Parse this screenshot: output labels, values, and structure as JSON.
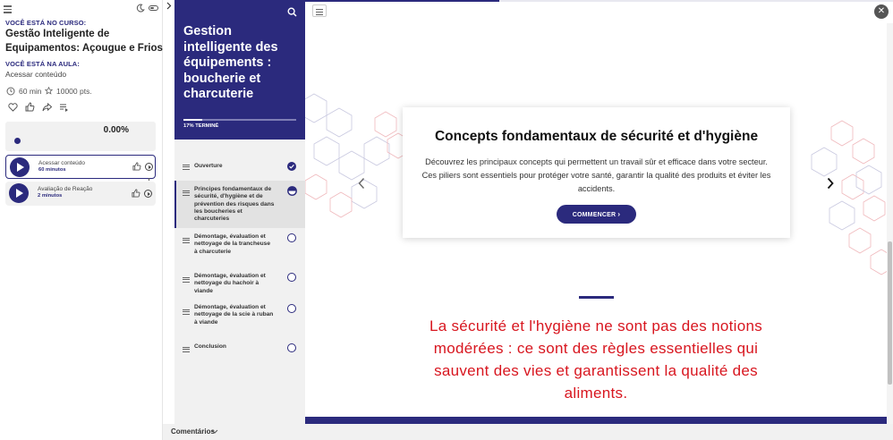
{
  "left": {
    "course_label": "VOCÊ ESTÁ NO CURSO:",
    "course_title": "Gestão Inteligente de Equipamentos: Açougue e Frios",
    "lesson_label": "VOCÊ ESTÁ NA AULA:",
    "lesson_name": "Acessar conteúdo",
    "duration": "60 min",
    "points": "10000 pts.",
    "progress_text": "0.00%",
    "progress": 0.0,
    "lessons": [
      {
        "title": "Acessar conteúdo",
        "subtitle": "60 minutos"
      },
      {
        "title": "Avaliação de Reação",
        "subtitle": "2 minutos"
      }
    ]
  },
  "module": {
    "title": "Gestion intelligente des équipements : boucherie et charcuterie",
    "progress_text": "17% TERMINÉ",
    "progress": 0.17,
    "items": [
      {
        "label": "Ouverture",
        "status": "done"
      },
      {
        "label": "Principes fondamentaux de sécurité, d'hygiène et de prévention des risques dans les boucheries et charcuteries",
        "status": "current"
      },
      {
        "label": "Démontage, évaluation et nettoyage de la trancheuse à charcuterie",
        "status": "todo"
      },
      {
        "label": "Démontage, évaluation et nettoyage du hachoir à viande",
        "status": "todo"
      },
      {
        "label": "Démontage, évaluation et nettoyage de la scie à ruban à viande",
        "status": "todo"
      },
      {
        "label": "Conclusion",
        "status": "todo"
      }
    ]
  },
  "main": {
    "card_title": "Concepts fondamentaux de sécurité et d'hygiène",
    "card_text": "Découvrez les principaux concepts qui permettent un travail sûr et efficace dans votre secteur. Ces piliers sont essentiels pour protéger votre santé, garantir la qualité des produits et éviter les accidents.",
    "start_label": "COMMENCER",
    "quote": "La sécurité et l'hygiène ne sont pas des notions modérées : ce sont des règles essentielles qui sauvent des vies et garantissent la qualité des aliments."
  },
  "footer": {
    "comments_label": "Comentários"
  },
  "colors": {
    "brand": "#2b2a7d",
    "accent_red": "#d8161f",
    "panel_gray": "#f1f1f1"
  },
  "icons": [
    "hamburger-icon",
    "moon-icon",
    "toggle-icon",
    "chevron-right-icon",
    "clock-icon",
    "star-icon",
    "heart-icon",
    "thumbs-up-icon",
    "share-icon",
    "playlist-icon",
    "search-icon",
    "close-icon",
    "chevron-left-icon"
  ]
}
